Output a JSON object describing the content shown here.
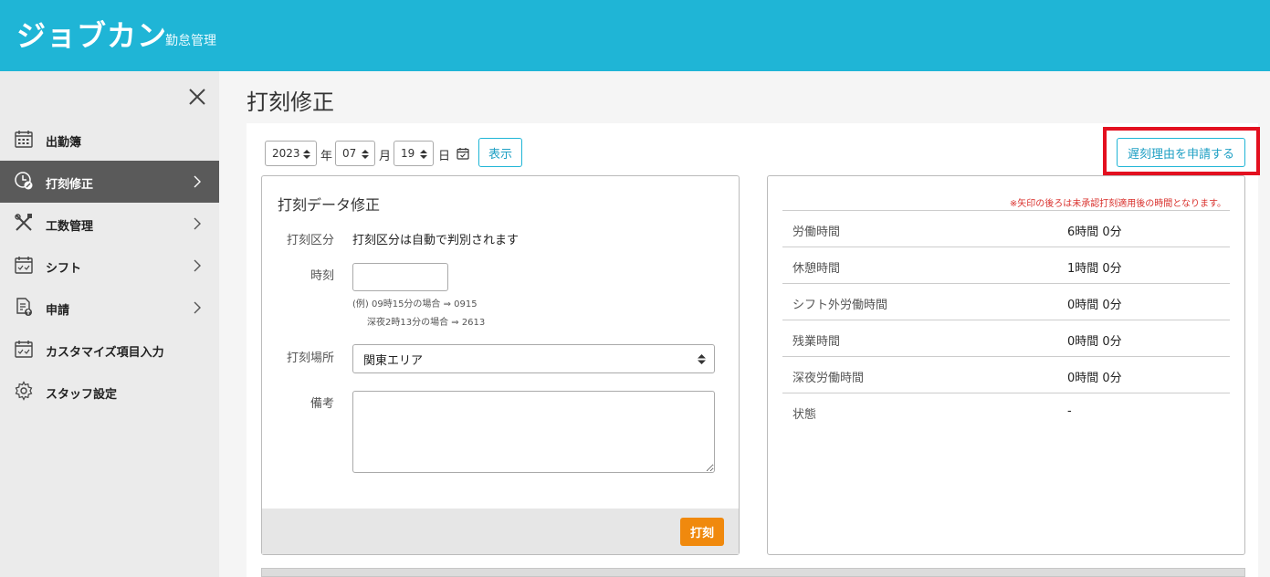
{
  "header": {
    "logo": "ジョブカン",
    "subtitle": "勤怠管理"
  },
  "sidebar": {
    "items": [
      {
        "label": "出勤簿",
        "icon": "calendar-grid-icon",
        "active": false,
        "chevron": false
      },
      {
        "label": "打刻修正",
        "icon": "clock-edit-icon",
        "active": true,
        "chevron": true
      },
      {
        "label": "工数管理",
        "icon": "tools-icon",
        "active": false,
        "chevron": true
      },
      {
        "label": "シフト",
        "icon": "calendar-check-icon",
        "active": false,
        "chevron": true
      },
      {
        "label": "申請",
        "icon": "document-upload-icon",
        "active": false,
        "chevron": true
      },
      {
        "label": "カスタマイズ項目入力",
        "icon": "calendar-check-icon",
        "active": false,
        "chevron": false
      },
      {
        "label": "スタッフ設定",
        "icon": "gear-icon",
        "active": false,
        "chevron": false
      }
    ]
  },
  "main": {
    "title": "打刻修正",
    "date": {
      "year": "2023",
      "year_label": "年",
      "month": "07",
      "month_label": "月",
      "day": "19",
      "day_label": "日",
      "show_button": "表示"
    },
    "late_reason_button": "遅刻理由を申請する",
    "stamp_form": {
      "title": "打刻データ修正",
      "type_label": "打刻区分",
      "type_value": "打刻区分は自動で判別されます",
      "time_label": "時刻",
      "time_value": "",
      "hint_line1": "(例) 09時15分の場合 ⇒ 0915",
      "hint_line2": "深夜2時13分の場合 ⇒ 2613",
      "location_label": "打刻場所",
      "location_value": "関東エリア",
      "memo_label": "備考",
      "memo_value": "",
      "submit_button": "打刻"
    },
    "summary": {
      "note": "※矢印の後ろは未承認打刻適用後の時間となります。",
      "rows": [
        {
          "label": "労働時間",
          "value": "6時間 0分"
        },
        {
          "label": "休憩時間",
          "value": "1時間 0分"
        },
        {
          "label": "シフト外労働時間",
          "value": "0時間 0分"
        },
        {
          "label": "残業時間",
          "value": "0時間 0分"
        },
        {
          "label": "深夜労働時間",
          "value": "0時間 0分"
        },
        {
          "label": "状態",
          "value": "-"
        }
      ]
    }
  },
  "colors": {
    "header": "#1fb5d6",
    "accent": "#1fa0c4",
    "submit": "#f0890d",
    "highlight": "#e3101f"
  }
}
